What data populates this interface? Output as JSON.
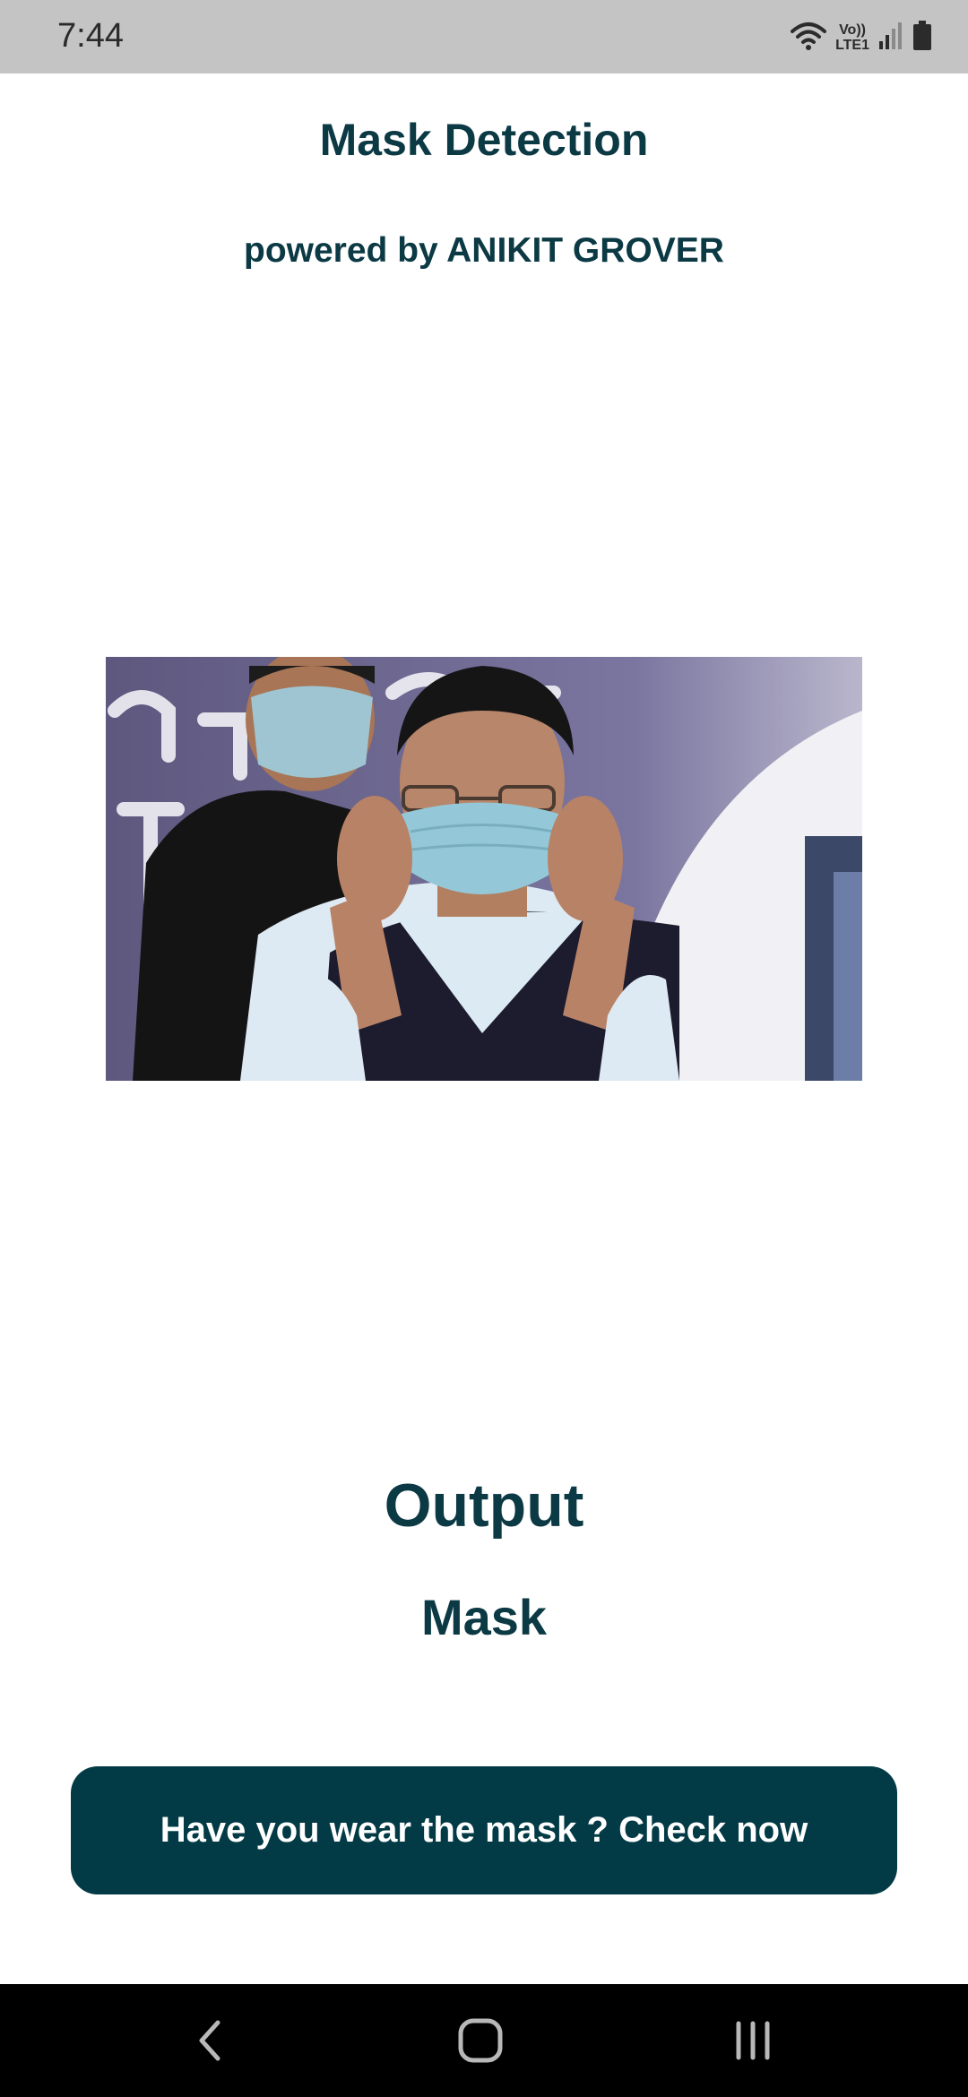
{
  "status_bar": {
    "time": "7:44",
    "network_label_top": "Vo))",
    "network_label_bottom": "LTE1",
    "icons": [
      "wifi-icon",
      "signal-icon",
      "battery-icon"
    ]
  },
  "header": {
    "title": "Mask Detection",
    "subtitle": "powered by ANIKIT GROVER"
  },
  "output": {
    "heading": "Output",
    "value": "Mask"
  },
  "actions": {
    "check_label": "Have you wear the mask ? Check now"
  },
  "nav_bar": {
    "icons": [
      "back-icon",
      "home-icon",
      "recents-icon"
    ]
  },
  "colors": {
    "accent": "#0b3944",
    "button": "#023a45",
    "status_bar": "#c4c4c4",
    "nav_bar": "#000000"
  }
}
